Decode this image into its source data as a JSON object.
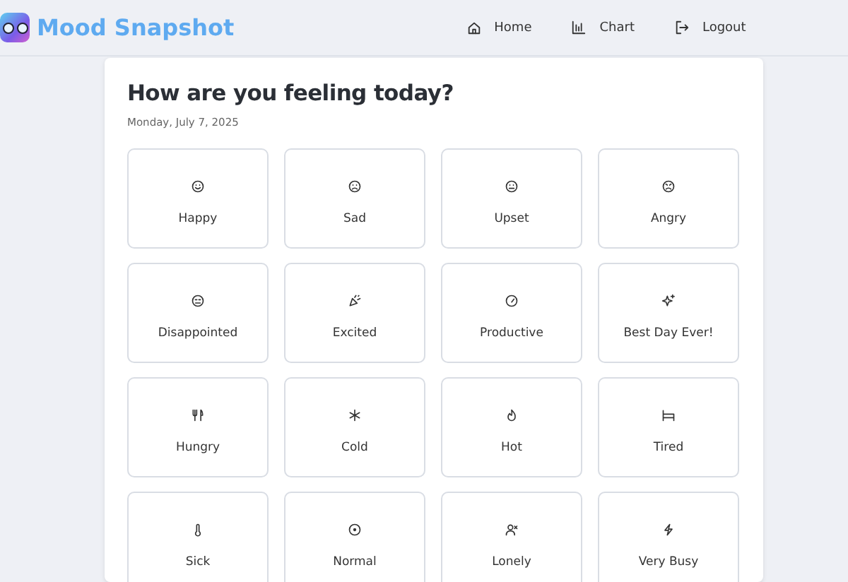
{
  "app": {
    "title": "Mood Snapshot"
  },
  "nav": [
    {
      "label": "Home",
      "kind": "home"
    },
    {
      "label": "Chart",
      "kind": "chart"
    },
    {
      "label": "Logout",
      "kind": "logout"
    }
  ],
  "heading": "How are you feeling today?",
  "date": "Monday, July 7, 2025",
  "moods": [
    {
      "label": "Happy",
      "kind": "smile"
    },
    {
      "label": "Sad",
      "kind": "frown"
    },
    {
      "label": "Upset",
      "kind": "meh"
    },
    {
      "label": "Angry",
      "kind": "angry"
    },
    {
      "label": "Disappointed",
      "kind": "flat"
    },
    {
      "label": "Excited",
      "kind": "party"
    },
    {
      "label": "Productive",
      "kind": "gauge"
    },
    {
      "label": "Best Day Ever!",
      "kind": "sparkles"
    },
    {
      "label": "Hungry",
      "kind": "utensils"
    },
    {
      "label": "Cold",
      "kind": "snowflake"
    },
    {
      "label": "Hot",
      "kind": "flame"
    },
    {
      "label": "Tired",
      "kind": "bed"
    },
    {
      "label": "Sick",
      "kind": "thermometer"
    },
    {
      "label": "Normal",
      "kind": "dot"
    },
    {
      "label": "Lonely",
      "kind": "userx"
    },
    {
      "label": "Very Busy",
      "kind": "zapoff"
    }
  ]
}
